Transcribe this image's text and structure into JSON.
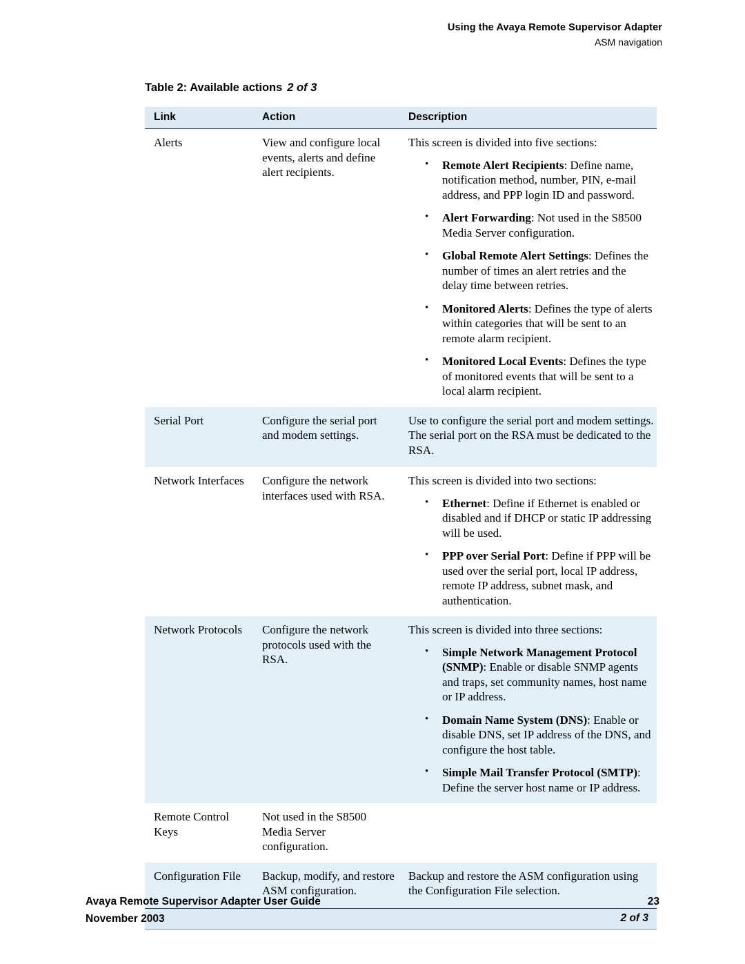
{
  "header": {
    "title": "Using the Avaya Remote Supervisor Adapter",
    "subtitle": "ASM navigation"
  },
  "table_caption": {
    "label": "Table 2: Available actions",
    "count": "2 of 3"
  },
  "table": {
    "columns": [
      "Link",
      "Action",
      "Description"
    ],
    "continuation": "2 of 3",
    "rows": [
      {
        "link": "Alerts",
        "action": "View and configure local events, alerts and define alert recipients.",
        "desc_lead": "This screen is divided into five sections:",
        "bullets": [
          {
            "term": "Remote Alert Recipients",
            "rest": ": Define name, notification method, number, PIN, e-mail address, and PPP login ID and password."
          },
          {
            "term": "Alert Forwarding",
            "rest": ": Not used in the S8500 Media Server configuration."
          },
          {
            "term": "Global Remote Alert Settings",
            "rest": ": Defines the number of times an alert retries and the delay time between retries."
          },
          {
            "term": "Monitored Alerts",
            "rest": ": Defines the type of alerts within categories that will be sent to an remote alarm recipient."
          },
          {
            "term": "Monitored Local Events",
            "rest": ": Defines the type of monitored events that will be sent to a local alarm recipient."
          }
        ]
      },
      {
        "link": "Serial Port",
        "action": "Configure the serial port and modem settings.",
        "desc_lead": "Use to configure the serial port and modem settings. The serial port on the RSA must be dedicated to the RSA.",
        "bullets": []
      },
      {
        "link": "Network Interfaces",
        "action": "Configure the network interfaces used with RSA.",
        "desc_lead": "This screen is divided into two sections:",
        "bullets": [
          {
            "term": "Ethernet",
            "rest": ": Define if Ethernet is enabled or disabled and if DHCP or static IP addressing will be used."
          },
          {
            "term": "PPP over Serial Port",
            "rest": ": Define if PPP will be used over the serial port, local IP address, remote IP address, subnet mask, and authentication."
          }
        ]
      },
      {
        "link": "Network Protocols",
        "action": "Configure the network protocols used with the RSA.",
        "desc_lead": "This screen is divided into three sections:",
        "bullets": [
          {
            "term": "Simple Network Management Protocol (SNMP)",
            "rest": ": Enable or disable SNMP agents and traps, set community names, host name or IP address."
          },
          {
            "term": "Domain Name System (DNS)",
            "rest": ": Enable or disable DNS, set IP address of the DNS, and configure the host table."
          },
          {
            "term": "Simple Mail Transfer Protocol (SMTP)",
            "rest": ": Define the server host name or IP address."
          }
        ]
      },
      {
        "link": "Remote Control Keys",
        "action": "Not used in the S8500 Media Server configuration.",
        "desc_lead": "",
        "bullets": []
      },
      {
        "link": "Configuration File",
        "action": "Backup, modify, and restore ASM configuration.",
        "desc_lead": "Backup and restore the ASM configuration using the Configuration File selection.",
        "bullets": []
      }
    ]
  },
  "footer": {
    "doc_title": "Avaya Remote Supervisor Adapter User Guide",
    "date": "November 2003",
    "page_number": "23"
  },
  "bullet_glyph": "•"
}
